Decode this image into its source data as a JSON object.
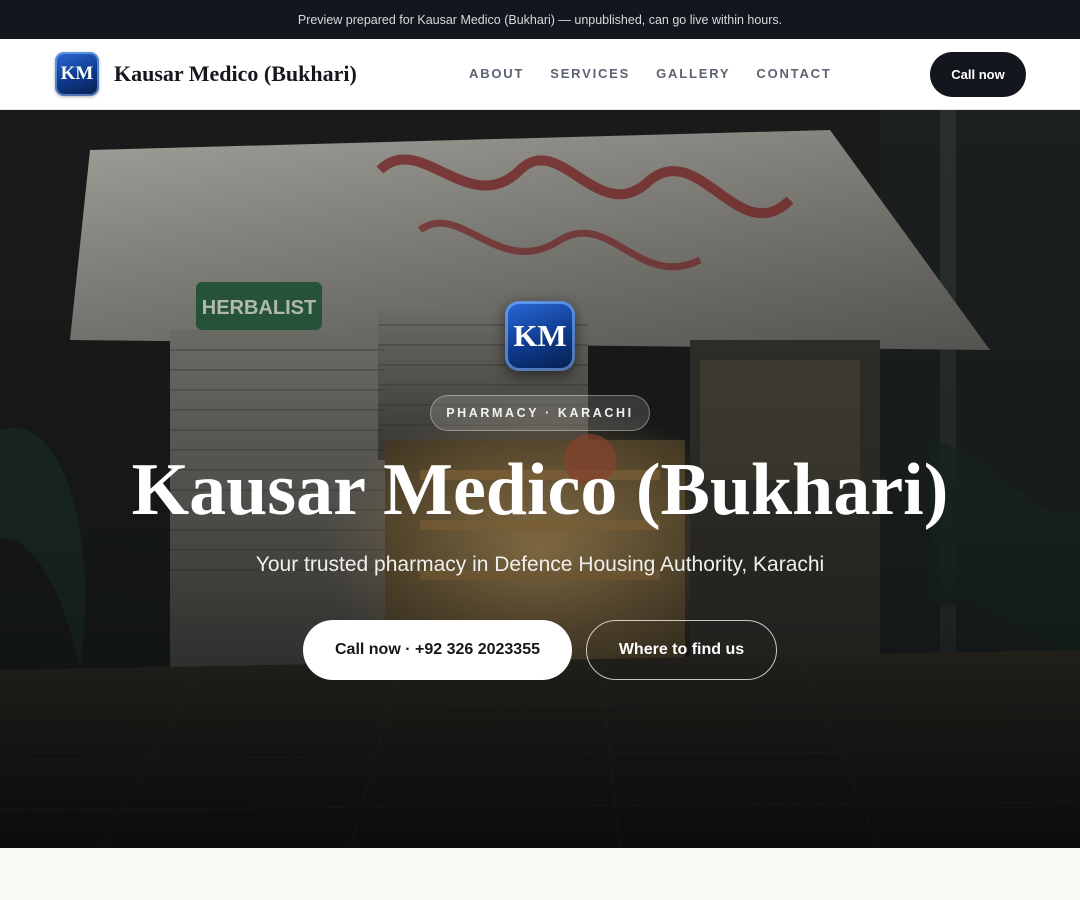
{
  "preview_bar": {
    "text": "Preview prepared for Kausar Medico (Bukhari) — unpublished, can go live within hours."
  },
  "header": {
    "logo_initials": "KM",
    "brand_name": "Kausar Medico (Bukhari)",
    "nav": [
      "ABOUT",
      "SERVICES",
      "GALLERY",
      "CONTACT"
    ],
    "call_label": "Call now"
  },
  "hero": {
    "logo_initials": "KM",
    "tag": "PHARMACY · KARACHI",
    "title": "Kausar Medico (Bukhari)",
    "subtitle": "Your trusted pharmacy in Defence Housing Authority, Karachi",
    "primary_cta": "Call now · +92 326 2023355",
    "secondary_cta": "Where to find us",
    "background_image": "night-storefront-pharmacy-photo"
  },
  "colors": {
    "dark": "#13161d",
    "logo_blue": "#0e3a8c",
    "page_bg": "#faf9f6",
    "nav_text": "#5c6270"
  }
}
